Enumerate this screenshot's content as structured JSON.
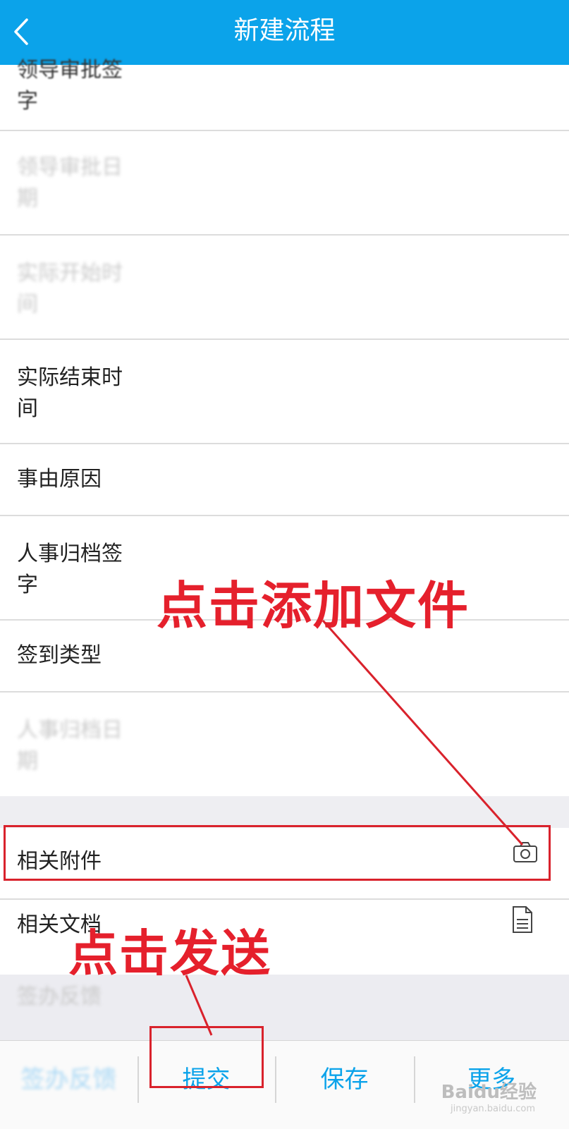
{
  "header": {
    "title": "新建流程",
    "back_icon": "chevron-left-icon"
  },
  "rows": {
    "r0": "领导审批签字",
    "r1": "领导审批日期",
    "r2": "实际开始时间",
    "r3": "实际结束时间",
    "r4": "事由原因",
    "r5": "人事归档签字",
    "r6": "签到类型",
    "r7": "人事归档日期"
  },
  "attachments": {
    "label": "相关附件",
    "icon": "camera-icon"
  },
  "documents": {
    "label": "相关文档",
    "icon": "document-icon"
  },
  "feedback_section": {
    "label": "签办反馈"
  },
  "bottom_bar": {
    "feedback": "签办反馈",
    "submit": "提交",
    "save": "保存",
    "more": "更多"
  },
  "annotations": {
    "add_file": "点击添加文件",
    "send": "点击发送"
  },
  "watermark": {
    "text": "Baidu经验",
    "url": "jingyan.baidu.com"
  },
  "colors": {
    "header": "#0ba3ea",
    "accent": "#0ba3ea",
    "annotation": "#e5202c"
  }
}
